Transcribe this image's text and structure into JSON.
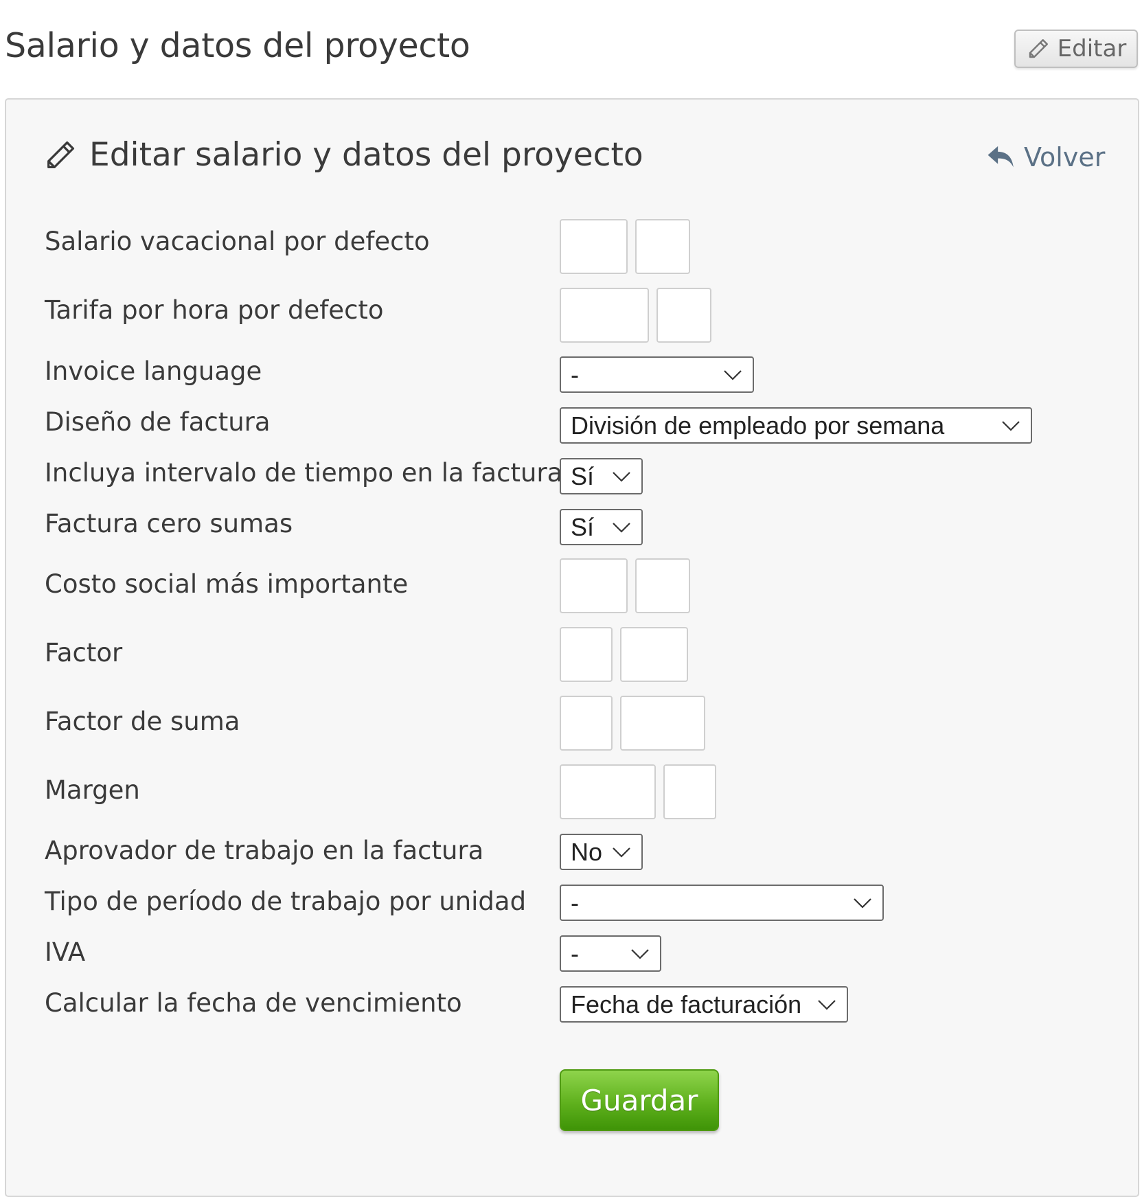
{
  "header": {
    "title": "Salario y datos del proyecto",
    "edit_label": "Editar"
  },
  "panel": {
    "title": "Editar salario y datos del proyecto",
    "back_label": "Volver"
  },
  "fields": {
    "vacation_salary": {
      "label": "Salario vacacional por defecto",
      "value_a": "",
      "value_b": ""
    },
    "hourly_rate": {
      "label": "Tarifa por hora por defecto",
      "value_a": "",
      "value_b": ""
    },
    "invoice_language": {
      "label": "Invoice language",
      "selected": "-"
    },
    "invoice_design": {
      "label": "Diseño de factura",
      "selected": "División de empleado por semana"
    },
    "include_interval": {
      "label": "Incluya intervalo de tiempo en la factura",
      "selected": "Sí"
    },
    "zero_sum_invoice": {
      "label": "Factura cero sumas",
      "selected": "Sí"
    },
    "social_cost": {
      "label": "Costo social más importante",
      "value_a": "",
      "value_b": ""
    },
    "factor": {
      "label": "Factor",
      "value_a": "",
      "value_b": ""
    },
    "sum_factor": {
      "label": "Factor de suma",
      "value_a": "",
      "value_b": ""
    },
    "margin": {
      "label": "Margen",
      "value_a": "",
      "value_b": ""
    },
    "work_approver": {
      "label": "Aprovador de trabajo en la factura",
      "selected": "No"
    },
    "work_period_type": {
      "label": "Tipo de período de trabajo por unidad",
      "selected": "-"
    },
    "vat": {
      "label": "IVA",
      "selected": "-"
    },
    "due_date_calc": {
      "label": "Calcular la fecha de vencimiento",
      "selected": "Fecha de facturación"
    }
  },
  "actions": {
    "save_label": "Guardar"
  },
  "icons": {
    "edit": "pencil-icon",
    "back": "reply-arrow-icon",
    "dropdown": "chevron-down-icon"
  },
  "colors": {
    "save_button": "#5fb11d",
    "back_link": "#5b7186",
    "panel_bg": "#f7f7f7"
  }
}
